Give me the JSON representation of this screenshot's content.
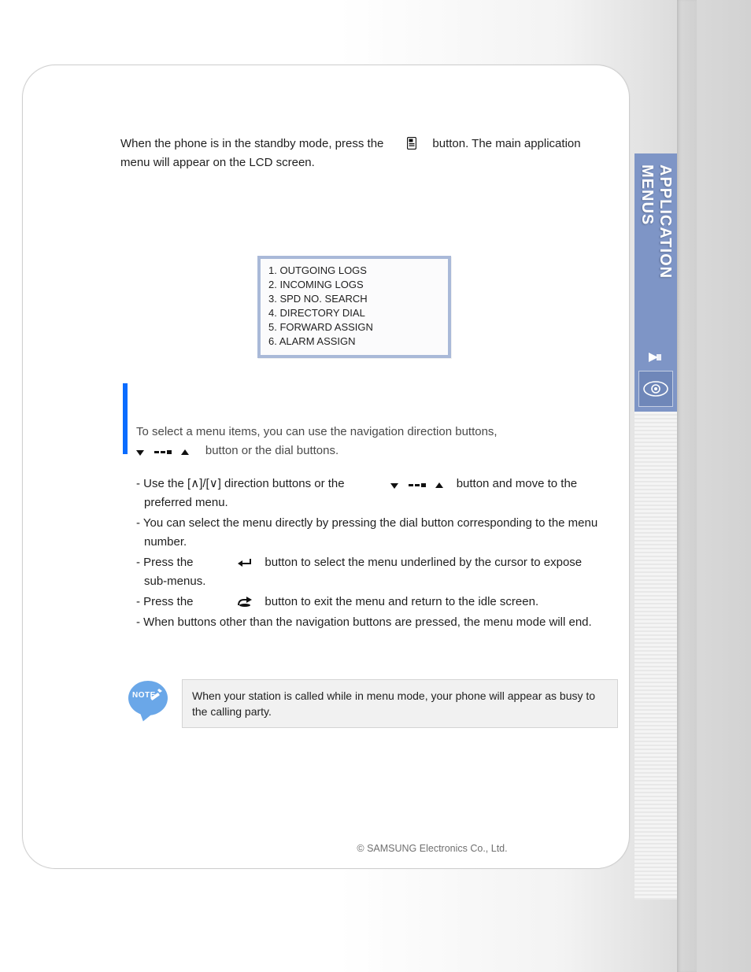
{
  "sideTab": {
    "label": "APPLICATION MENUS"
  },
  "intro": {
    "part1": "When the phone is in the standby mode, press the",
    "part2": "button. The main application menu will appear on the LCD screen."
  },
  "lcd": {
    "items": [
      "1. OUTGOING LOGS",
      "2. INCOMING LOGS",
      "3. SPD NO. SEARCH",
      "4. DIRECTORY DIAL",
      "5. FORWARD ASSIGN",
      "6. ALARM ASSIGN"
    ]
  },
  "selectBlock": {
    "line1": "To select a menu items, you can use the navigation direction buttons,",
    "line2_tail": "button or the dial buttons."
  },
  "tips": {
    "t1a": "- Use the [",
    "t1b": "]/[",
    "t1c": "] direction buttons or the",
    "t1d": "button and move to the preferred menu.",
    "t2": "- You can select the menu directly by pressing the dial button corresponding to the menu number.",
    "t3a": "- Press the",
    "t3b": "button to select the menu underlined by the cursor to expose sub-menus.",
    "t4a": "- Press the",
    "t4b": "button to exit the menu and return to the idle screen.",
    "t5": "- When buttons other than the navigation buttons are pressed, the menu mode will end."
  },
  "note": {
    "badge": "NOTE",
    "text": "When your station is called while in menu mode, your phone will appear as busy to the calling party."
  },
  "footer": {
    "copyright": "© SAMSUNG Electronics Co., Ltd."
  }
}
